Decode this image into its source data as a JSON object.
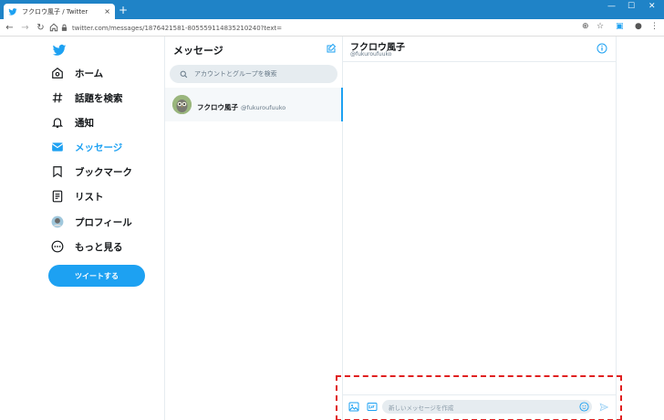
{
  "browser": {
    "tab_title": "フクロウ風子 / Twitter",
    "tab_close": "×",
    "new_tab": "+",
    "url": "twitter.com/messages/1876421581-805559114835210240?text=",
    "window_minimize": "—",
    "window_maximize": "☐",
    "window_close": "✕"
  },
  "nav": {
    "items": [
      {
        "label": "ホーム",
        "icon": "home-icon"
      },
      {
        "label": "話題を検索",
        "icon": "hashtag-icon"
      },
      {
        "label": "通知",
        "icon": "bell-icon"
      },
      {
        "label": "メッセージ",
        "icon": "mail-icon",
        "active": true
      },
      {
        "label": "ブックマーク",
        "icon": "bookmark-icon"
      },
      {
        "label": "リスト",
        "icon": "list-icon"
      },
      {
        "label": "プロフィール",
        "icon": "avatar-icon"
      },
      {
        "label": "もっと見る",
        "icon": "more-icon"
      }
    ],
    "tweet_button": "ツイートする"
  },
  "messages": {
    "header": "メッセージ",
    "search_placeholder": "アカウントとグループを検索",
    "conversations": [
      {
        "name": "フクロウ風子",
        "handle": "@fukuroufuuko"
      }
    ]
  },
  "conversation": {
    "name": "フクロウ風子",
    "handle": "@fukuroufuuko",
    "input_placeholder": "新しいメッセージを作成"
  },
  "colors": {
    "accent": "#1da1f2",
    "chrome_bar": "#1f83c7",
    "highlight": "#e02020"
  }
}
